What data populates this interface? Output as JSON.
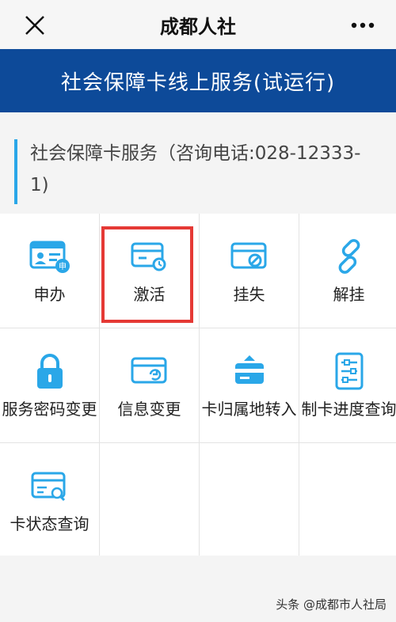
{
  "header": {
    "title": "成都人社",
    "close_icon": "close-icon",
    "more_icon": "more-dots-icon"
  },
  "banner": {
    "text": "社会保障卡线上服务(试运行)"
  },
  "section": {
    "title": "社会保障卡服务（咨询电话:028-12333-1)"
  },
  "services": [
    {
      "label": "申办",
      "icon": "id-card-apply-icon"
    },
    {
      "label": "激活",
      "icon": "card-activate-icon"
    },
    {
      "label": "挂失",
      "icon": "card-report-loss-icon"
    },
    {
      "label": "解挂",
      "icon": "link-unlock-icon"
    },
    {
      "label": "服务密码变更",
      "icon": "lock-icon"
    },
    {
      "label": "信息变更",
      "icon": "card-refresh-icon"
    },
    {
      "label": "卡归属地转入",
      "icon": "card-transfer-icon"
    },
    {
      "label": "制卡进度查询",
      "icon": "progress-sliders-icon"
    },
    {
      "label": "卡状态查询",
      "icon": "card-search-icon"
    }
  ],
  "watermark": {
    "text": "头条 @成都市人社局"
  },
  "colors": {
    "banner": "#0d4a99",
    "accent": "#2aa7e8",
    "highlight": "#e53935"
  }
}
